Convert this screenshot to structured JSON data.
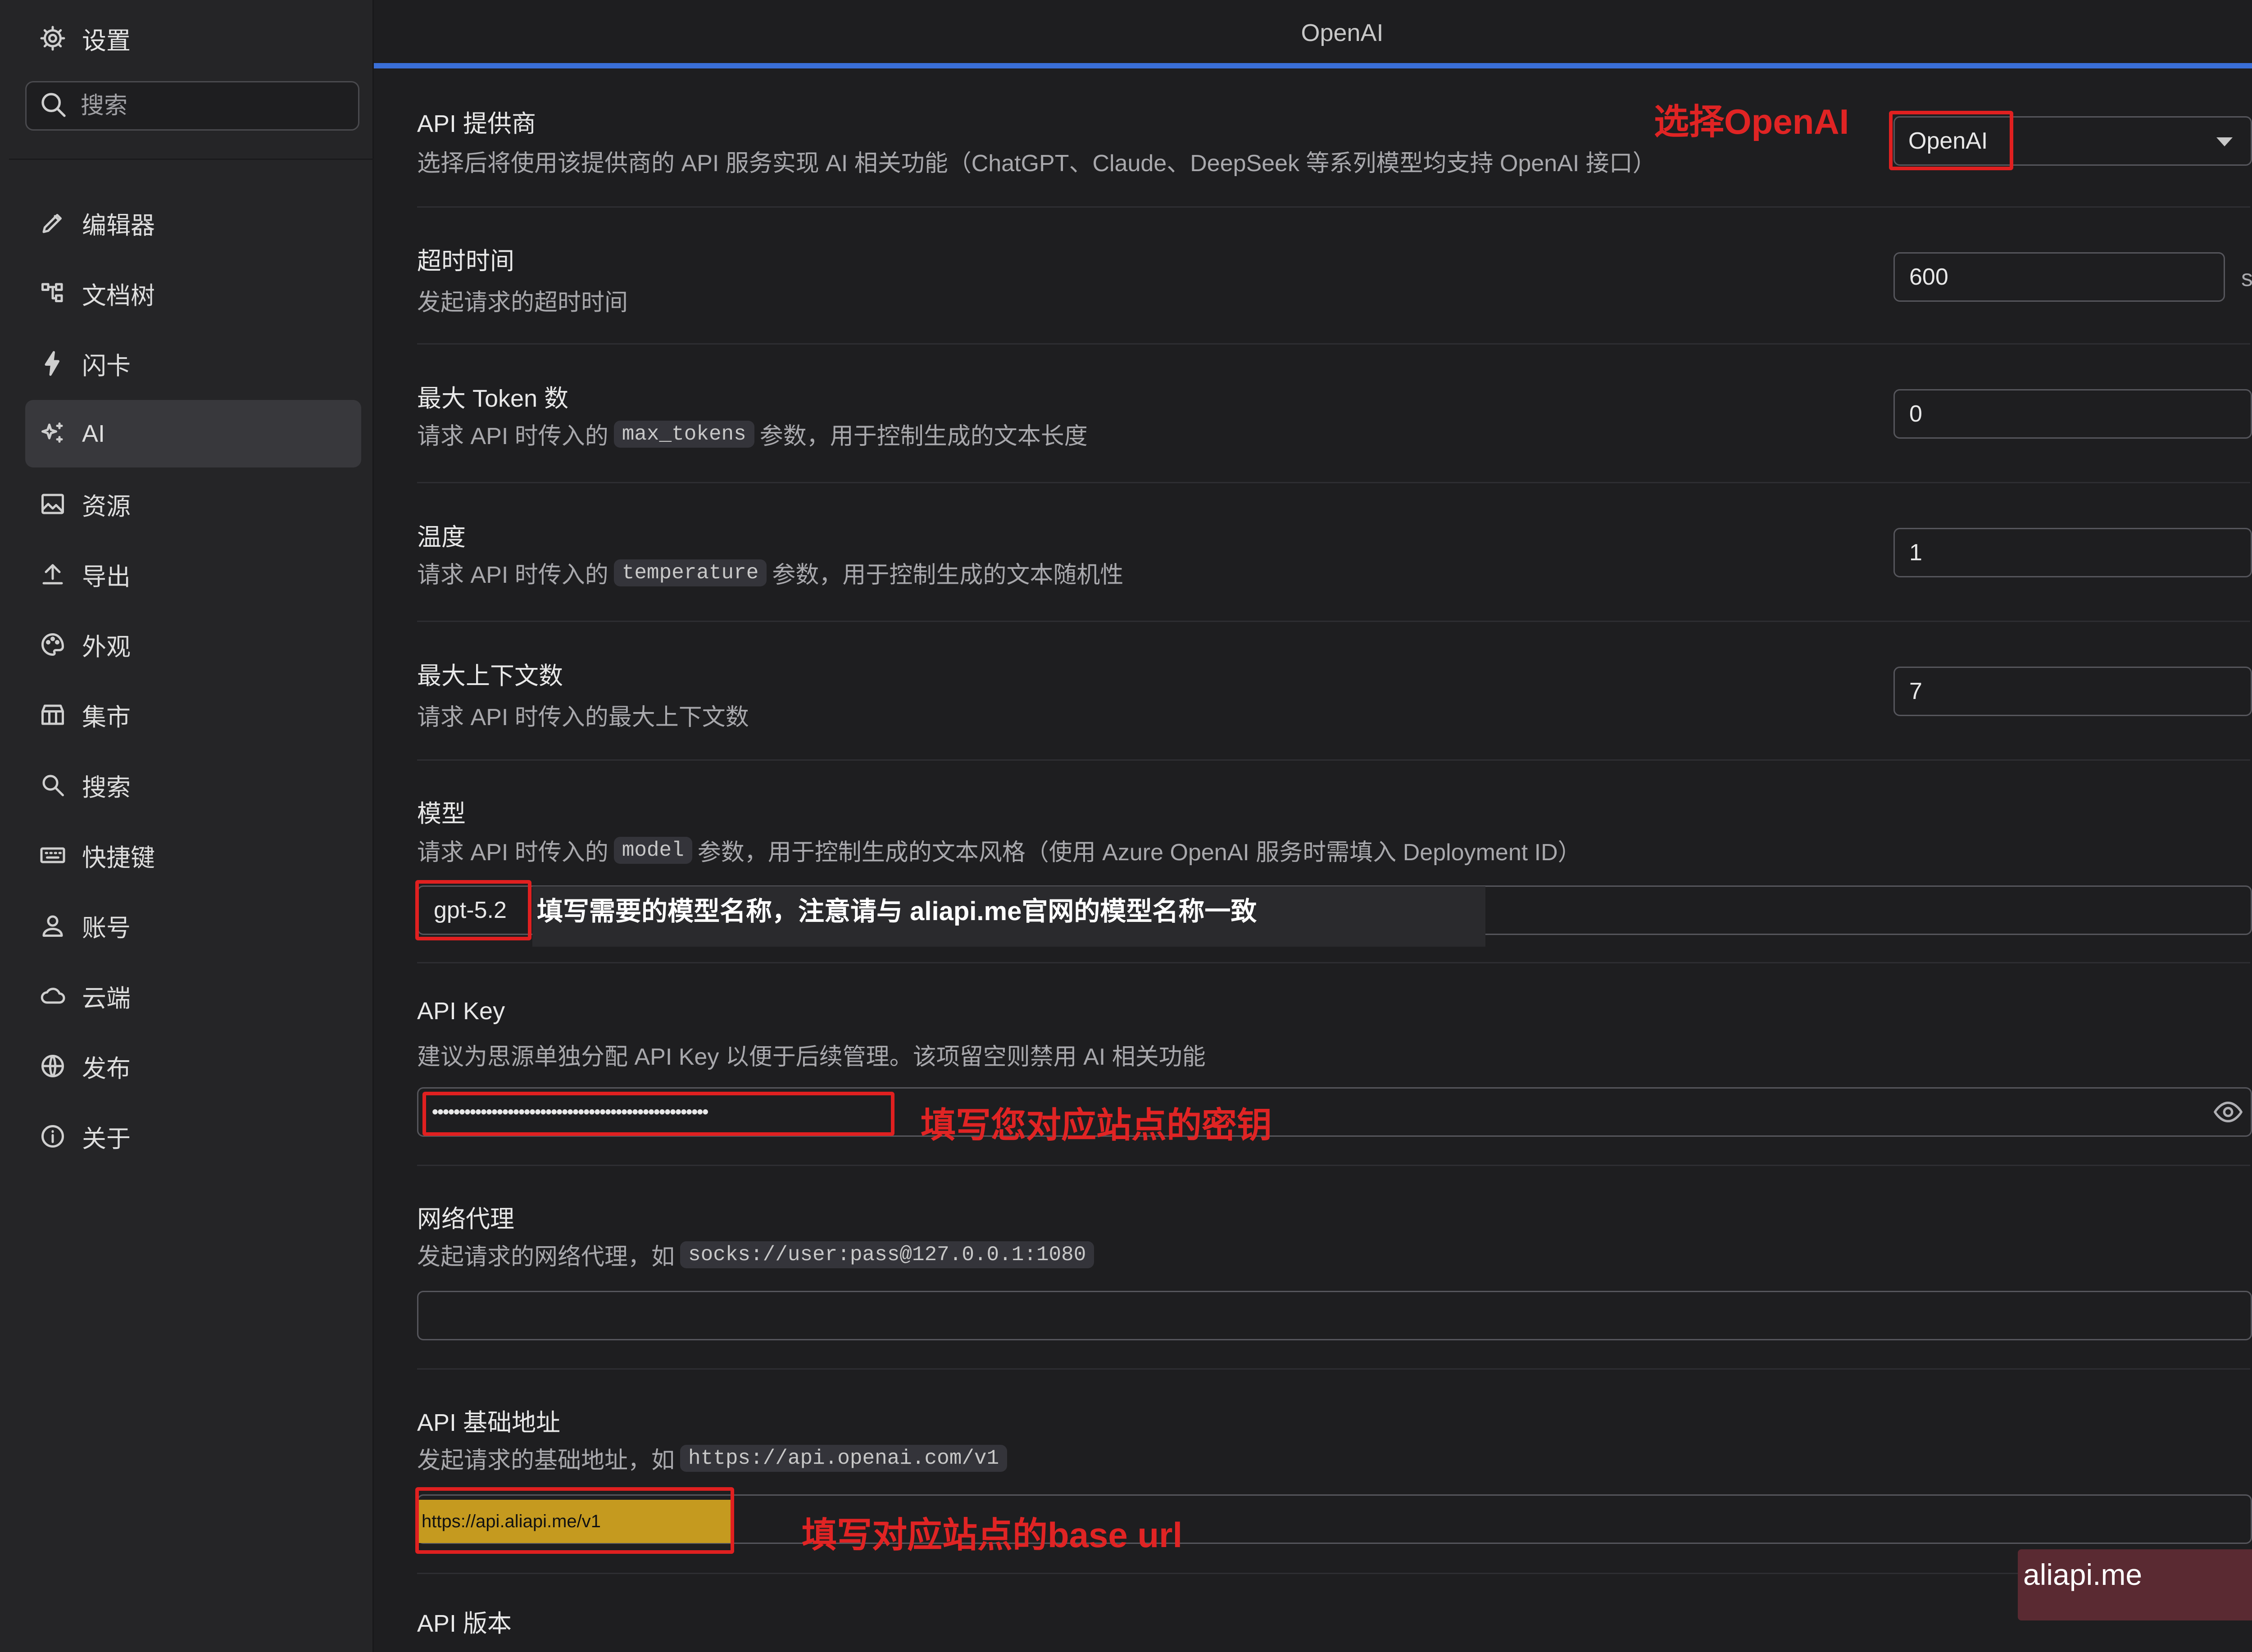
{
  "sidebar": {
    "title": "设置",
    "search_placeholder": "搜索",
    "items": [
      {
        "label": "编辑器",
        "icon": "pencil-icon"
      },
      {
        "label": "文档树",
        "icon": "tree-icon"
      },
      {
        "label": "闪卡",
        "icon": "bolt-icon"
      },
      {
        "label": "AI",
        "icon": "sparkle-icon",
        "active": true
      },
      {
        "label": "资源",
        "icon": "image-icon"
      },
      {
        "label": "导出",
        "icon": "upload-icon"
      },
      {
        "label": "外观",
        "icon": "palette-icon"
      },
      {
        "label": "集市",
        "icon": "store-icon"
      },
      {
        "label": "搜索",
        "icon": "search-icon"
      },
      {
        "label": "快捷键",
        "icon": "keyboard-icon"
      },
      {
        "label": "账号",
        "icon": "user-icon"
      },
      {
        "label": "云端",
        "icon": "cloud-icon"
      },
      {
        "label": "发布",
        "icon": "globe-icon"
      },
      {
        "label": "关于",
        "icon": "info-icon"
      }
    ]
  },
  "header": {
    "title": "OpenAI",
    "accent": "#3a6fd8"
  },
  "settings": {
    "provider": {
      "label": "API 提供商",
      "desc": "选择后将使用该提供商的 API 服务实现 AI 相关功能（ChatGPT、Claude、DeepSeek 等系列模型均支持 OpenAI 接口）",
      "value": "OpenAI"
    },
    "timeout": {
      "label": "超时时间",
      "desc": "发起请求的超时时间",
      "value": "600",
      "unit": "s"
    },
    "max_tokens": {
      "label": "最大 Token 数",
      "desc_pre": "请求 API 时传入的",
      "code": "max_tokens",
      "desc_post": "参数，用于控制生成的文本长度",
      "value": "0"
    },
    "temperature": {
      "label": "温度",
      "desc_pre": "请求 API 时传入的",
      "code": "temperature",
      "desc_post": "参数，用于控制生成的文本随机性",
      "value": "1"
    },
    "max_context": {
      "label": "最大上下文数",
      "desc": "请求 API 时传入的最大上下文数",
      "value": "7"
    },
    "model": {
      "label": "模型",
      "desc_pre": "请求 API 时传入的",
      "code": "model",
      "desc_post": "参数，用于控制生成的文本风格（使用 Azure OpenAI 服务时需填入 Deployment ID）",
      "value": "gpt-5.2"
    },
    "api_key": {
      "label": "API Key",
      "desc": "建议为思源单独分配 API Key 以便于后续管理。该项留空则禁用 AI 相关功能",
      "value": "•••••••••••••••••••••••••••••••••••••••••••••••••••"
    },
    "proxy": {
      "label": "网络代理",
      "desc_pre": "发起请求的网络代理，如",
      "code": "socks://user:pass@127.0.0.1:1080",
      "value": ""
    },
    "base_url": {
      "label": "API 基础地址",
      "desc_pre": "发起请求的基础地址，如",
      "code": "https://api.openai.com/v1",
      "value": "https://api.aliapi.me/v1"
    },
    "api_version": {
      "label": "API 版本"
    }
  },
  "annotations": {
    "provider": "选择OpenAI",
    "model": "填写需要的模型名称，注意请与 aliapi.me官网的模型名称一致",
    "api_key": "填写您对应站点的密钥",
    "base_url": "填写对应站点的base url",
    "color": "#e02020"
  },
  "watermark": "aliapi.me"
}
